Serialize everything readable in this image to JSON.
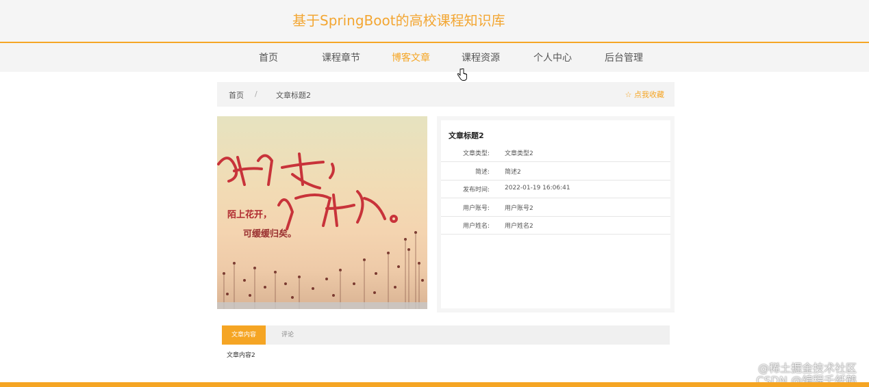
{
  "site": {
    "title": "基于SpringBoot的高校课程知识库"
  },
  "nav": {
    "items": [
      {
        "label": "首页"
      },
      {
        "label": "课程章节"
      },
      {
        "label": "博客文章"
      },
      {
        "label": "课程资源"
      },
      {
        "label": "个人中心"
      },
      {
        "label": "后台管理"
      }
    ],
    "active_index": 2
  },
  "breadcrumb": {
    "home": "首页",
    "separator": "/",
    "current": "文章标题2",
    "favorite_label": "☆ 点我收藏"
  },
  "article": {
    "image_caption": "article-cover",
    "title": "文章标题2",
    "fields": [
      {
        "label": "文章类型:",
        "value": "文章类型2"
      },
      {
        "label": "简述:",
        "value": "简述2"
      },
      {
        "label": "发布时间:",
        "value": "2022-01-19 16:06:41"
      },
      {
        "label": "用户账号:",
        "value": "用户账号2"
      },
      {
        "label": "用户姓名:",
        "value": "用户姓名2"
      }
    ]
  },
  "tabs": {
    "content_label": "文章内容",
    "comment_label": "评论",
    "content_text": "文章内容2"
  },
  "watermark": {
    "line1": "@稀土掘金技术社区",
    "line2": "CSDN @编程千纸鹤"
  },
  "colors": {
    "accent": "#f5a524",
    "header_bg": "#f5f5f5"
  }
}
